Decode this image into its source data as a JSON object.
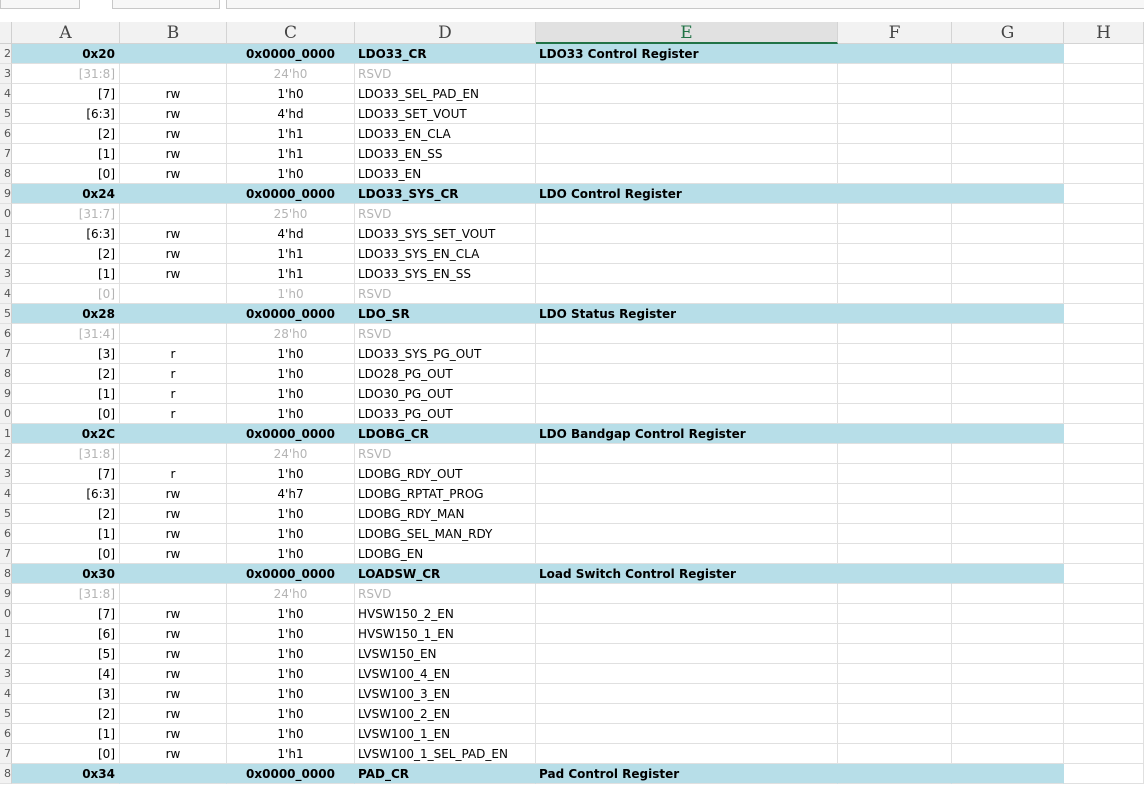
{
  "columns": [
    "A",
    "B",
    "C",
    "D",
    "E",
    "F",
    "G",
    "H"
  ],
  "selected_column": "E",
  "row_numbers": [
    "2",
    "3",
    "4",
    "5",
    "6",
    "7",
    "8",
    "9",
    "0",
    "1",
    "2",
    "3",
    "4",
    "5",
    "6",
    "7",
    "8",
    "9",
    "0",
    "1",
    "2",
    "3",
    "4",
    "5",
    "6",
    "7",
    "8",
    "9",
    "0",
    "1",
    "2",
    "3",
    "4",
    "5",
    "6",
    "7",
    "8"
  ],
  "rows": [
    {
      "type": "header",
      "a": "0x20",
      "b": "",
      "c": "0x0000_0000",
      "d": "LDO33_CR",
      "e": "LDO33 Control Register"
    },
    {
      "type": "reserved",
      "a": "[31:8]",
      "b": "",
      "c": "24'h0",
      "d": "RSVD",
      "e": ""
    },
    {
      "type": "field",
      "a": "[7]",
      "b": "rw",
      "c": "1'h0",
      "d": "LDO33_SEL_PAD_EN",
      "e": ""
    },
    {
      "type": "field",
      "a": "[6:3]",
      "b": "rw",
      "c": "4'hd",
      "d": "LDO33_SET_VOUT",
      "e": ""
    },
    {
      "type": "field",
      "a": "[2]",
      "b": "rw",
      "c": "1'h1",
      "d": "LDO33_EN_CLA",
      "e": ""
    },
    {
      "type": "field",
      "a": "[1]",
      "b": "rw",
      "c": "1'h1",
      "d": "LDO33_EN_SS",
      "e": ""
    },
    {
      "type": "field",
      "a": "[0]",
      "b": "rw",
      "c": "1'h0",
      "d": "LDO33_EN",
      "e": ""
    },
    {
      "type": "header",
      "a": "0x24",
      "b": "",
      "c": "0x0000_0000",
      "d": "LDO33_SYS_CR",
      "e": "LDO Control Register"
    },
    {
      "type": "reserved",
      "a": "[31:7]",
      "b": "",
      "c": "25'h0",
      "d": "RSVD",
      "e": ""
    },
    {
      "type": "field",
      "a": "[6:3]",
      "b": "rw",
      "c": "4'hd",
      "d": "LDO33_SYS_SET_VOUT",
      "e": ""
    },
    {
      "type": "field",
      "a": "[2]",
      "b": "rw",
      "c": "1'h1",
      "d": "LDO33_SYS_EN_CLA",
      "e": ""
    },
    {
      "type": "field",
      "a": "[1]",
      "b": "rw",
      "c": "1'h1",
      "d": "LDO33_SYS_EN_SS",
      "e": ""
    },
    {
      "type": "reserved",
      "a": "[0]",
      "b": "",
      "c": "1'h0",
      "d": "RSVD",
      "e": ""
    },
    {
      "type": "header",
      "a": "0x28",
      "b": "",
      "c": "0x0000_0000",
      "d": "LDO_SR",
      "e": "LDO Status Register"
    },
    {
      "type": "reserved",
      "a": "[31:4]",
      "b": "",
      "c": "28'h0",
      "d": "RSVD",
      "e": ""
    },
    {
      "type": "field",
      "a": "[3]",
      "b": "r",
      "c": "1'h0",
      "d": "LDO33_SYS_PG_OUT",
      "e": ""
    },
    {
      "type": "field",
      "a": "[2]",
      "b": "r",
      "c": "1'h0",
      "d": "LDO28_PG_OUT",
      "e": ""
    },
    {
      "type": "field",
      "a": "[1]",
      "b": "r",
      "c": "1'h0",
      "d": "LDO30_PG_OUT",
      "e": ""
    },
    {
      "type": "field",
      "a": "[0]",
      "b": "r",
      "c": "1'h0",
      "d": "LDO33_PG_OUT",
      "e": ""
    },
    {
      "type": "header",
      "a": "0x2C",
      "b": "",
      "c": "0x0000_0000",
      "d": "LDOBG_CR",
      "e": "LDO Bandgap Control Register"
    },
    {
      "type": "reserved",
      "a": "[31:8]",
      "b": "",
      "c": "24'h0",
      "d": "RSVD",
      "e": ""
    },
    {
      "type": "field",
      "a": "[7]",
      "b": "r",
      "c": "1'h0",
      "d": "LDOBG_RDY_OUT",
      "e": ""
    },
    {
      "type": "field",
      "a": "[6:3]",
      "b": "rw",
      "c": "4'h7",
      "d": "LDOBG_RPTAT_PROG",
      "e": ""
    },
    {
      "type": "field",
      "a": "[2]",
      "b": "rw",
      "c": "1'h0",
      "d": "LDOBG_RDY_MAN",
      "e": ""
    },
    {
      "type": "field",
      "a": "[1]",
      "b": "rw",
      "c": "1'h0",
      "d": "LDOBG_SEL_MAN_RDY",
      "e": ""
    },
    {
      "type": "field",
      "a": "[0]",
      "b": "rw",
      "c": "1'h0",
      "d": "LDOBG_EN",
      "e": ""
    },
    {
      "type": "header",
      "a": "0x30",
      "b": "",
      "c": "0x0000_0000",
      "d": "LOADSW_CR",
      "e": "Load Switch Control Register"
    },
    {
      "type": "reserved",
      "a": "[31:8]",
      "b": "",
      "c": "24'h0",
      "d": "RSVD",
      "e": ""
    },
    {
      "type": "field",
      "a": "[7]",
      "b": "rw",
      "c": "1'h0",
      "d": "HVSW150_2_EN",
      "e": ""
    },
    {
      "type": "field",
      "a": "[6]",
      "b": "rw",
      "c": "1'h0",
      "d": "HVSW150_1_EN",
      "e": ""
    },
    {
      "type": "field",
      "a": "[5]",
      "b": "rw",
      "c": "1'h0",
      "d": "LVSW150_EN",
      "e": ""
    },
    {
      "type": "field",
      "a": "[4]",
      "b": "rw",
      "c": "1'h0",
      "d": "LVSW100_4_EN",
      "e": ""
    },
    {
      "type": "field",
      "a": "[3]",
      "b": "rw",
      "c": "1'h0",
      "d": "LVSW100_3_EN",
      "e": ""
    },
    {
      "type": "field",
      "a": "[2]",
      "b": "rw",
      "c": "1'h0",
      "d": "LVSW100_2_EN",
      "e": ""
    },
    {
      "type": "field",
      "a": "[1]",
      "b": "rw",
      "c": "1'h0",
      "d": "LVSW100_1_EN",
      "e": ""
    },
    {
      "type": "field",
      "a": "[0]",
      "b": "rw",
      "c": "1'h1",
      "d": "LVSW100_1_SEL_PAD_EN",
      "e": ""
    },
    {
      "type": "header",
      "a": "0x34",
      "b": "",
      "c": "0x0000_0000",
      "d": "PAD_CR",
      "e": "Pad Control Register"
    }
  ]
}
